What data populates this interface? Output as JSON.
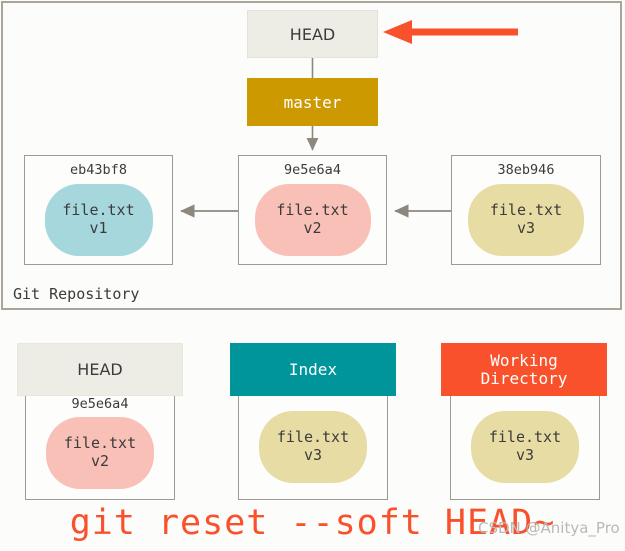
{
  "diagram": {
    "title": "git reset --soft HEAD~ illustration",
    "repository": {
      "label": "Git Repository",
      "head_pointer": {
        "label": "HEAD"
      },
      "branch": {
        "label": "master"
      },
      "commits": [
        {
          "hash": "eb43bf8",
          "file": "file.txt",
          "version": "v1",
          "color": "#a5d7dc"
        },
        {
          "hash": "9e5e6a4",
          "file": "file.txt",
          "version": "v2",
          "color": "#f9c0b8"
        },
        {
          "hash": "38eb946",
          "file": "file.txt",
          "version": "v3",
          "color": "#e8dca5"
        }
      ]
    },
    "areas": [
      {
        "name": "HEAD",
        "header_color": "#eeede5",
        "hash": "9e5e6a4",
        "file": "file.txt",
        "version": "v2",
        "blob_color": "#f9c0b8"
      },
      {
        "name": "Index",
        "header_color": "#00959b",
        "hash": "",
        "file": "file.txt",
        "version": "v3",
        "blob_color": "#e8dca5"
      },
      {
        "name": "Working\nDirectory",
        "name_line1": "Working",
        "name_line2": "Directory",
        "header_color": "#f8512c",
        "hash": "",
        "file": "file.txt",
        "version": "v3",
        "blob_color": "#e8dca5"
      }
    ],
    "command": "git reset --soft HEAD~",
    "watermark": "CSDN @Anitya_Pro",
    "colors": {
      "background": "#fcfcfa",
      "panel_border": "#aaa49b",
      "connector": "#8c8880",
      "red_arrow": "#f8512c",
      "master_gold": "#cc9a00",
      "text": "#3b3b3b"
    }
  }
}
